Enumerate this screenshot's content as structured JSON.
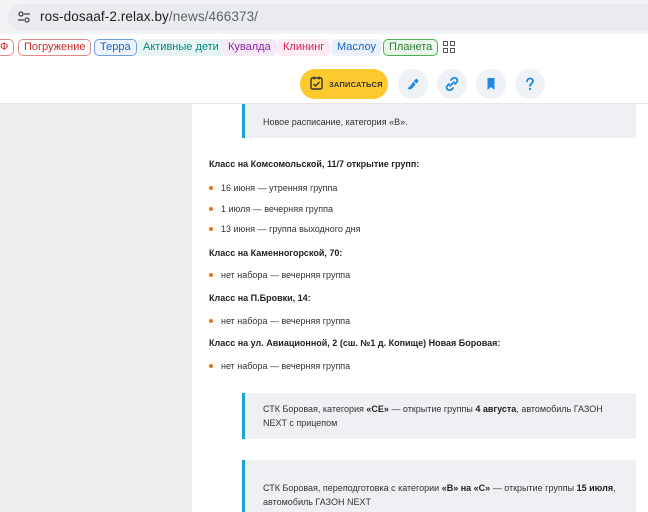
{
  "browser": {
    "url_host": "ros-dosaaf-2.relax.by",
    "url_path": "/news/466373/"
  },
  "bookmarks": [
    "Ф",
    "Погружение",
    "Терра",
    "Активные дети",
    "Кувалда",
    "Клининг",
    "Маслоу",
    "Планета"
  ],
  "toolbar": {
    "enroll_label": "ЗАПИСАТЬСЯ",
    "icons": [
      "phone-icon",
      "link-icon",
      "bookmark-icon",
      "help-icon"
    ]
  },
  "article": {
    "note1": "Новое расписание, категория «В».",
    "sections": [
      {
        "heading": "Класс на Комсомольской, 11/7 открытие групп:",
        "items": [
          "16 июня — утренняя группа",
          "1 июля — вечерняя группа",
          "13 июня — группа выходного дня"
        ]
      },
      {
        "heading": "Класс на Каменногорской, 70:",
        "items": [
          "нет набора — вечерняя группа"
        ]
      },
      {
        "heading": "Класс на П.Бровки, 14:",
        "items": [
          "нет набора — вечерняя группа"
        ]
      },
      {
        "heading": "Класс на ул. Авиационной, 2 (сш. №1 д. Копище) Новая Боровая:",
        "items": [
          "нет набора — вечерняя группа"
        ]
      }
    ],
    "note2": {
      "p1": "СТК Боровая, категория ",
      "b1": "«СЕ»",
      "p2": " — открытие группы ",
      "b2": "4 августа",
      "p3": ", автомобиль ГАЗОН NEXT с прицепом"
    },
    "note3": {
      "p1": "СТК Боровая, переподготовка с категории ",
      "b1": "«В» на «С»",
      "p2": " — открытие группы ",
      "b2": "15 июля",
      "p3": ", автомобиль ГАЗОН NEXT"
    }
  },
  "colors": {
    "accent_yellow": "#fcc92e",
    "note_border": "#1aa3d9",
    "bullet": "#e8731f",
    "icon_blue": "#1e88e5"
  }
}
